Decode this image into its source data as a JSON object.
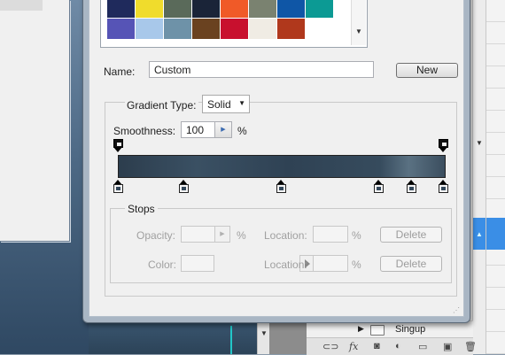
{
  "presets": {
    "swatches_row1": [
      "#1f2a5c",
      "#f0dc2c",
      "#5a6a5a",
      "#1a2438",
      "#f05a28",
      "#7a8270",
      "#0f56a6",
      "#0c9a94"
    ],
    "swatches_row2": [
      "#5654b6",
      "#a8c8ea",
      "#6e92a8",
      "#6a4220",
      "#c8102e",
      "#f0ece4",
      "#b0381c",
      "#ffffff"
    ],
    "scroll_down_icon": "▼"
  },
  "name": {
    "label": "Name:",
    "value": "Custom",
    "new_button": "New"
  },
  "gradient": {
    "type_label": "Gradient Type:",
    "type_value": "Solid",
    "smoothness_label": "Smoothness:",
    "smoothness_value": "100",
    "smoothness_unit": "%",
    "opacity_stop_count": 2,
    "color_stop_count": 6
  },
  "stops": {
    "group_label": "Stops",
    "opacity_label": "Opacity:",
    "opacity_unit": "%",
    "location_label_1": "Location:",
    "location_unit_1": "%",
    "delete_1": "Delete",
    "color_label": "Color:",
    "location_label_2": "Location:",
    "location_unit_2": "%",
    "delete_2": "Delete"
  },
  "layers": {
    "layer_name": "Singup",
    "toolbar_icons": [
      "link-icon",
      "fx-icon",
      "mask-icon",
      "adjustment-icon",
      "folder-icon",
      "new-layer-icon",
      "trash-icon"
    ],
    "fx_label": "fx"
  },
  "colors": {
    "accent_selection": "#3a8ee6",
    "dialog_frame": "#a9b6c4"
  }
}
